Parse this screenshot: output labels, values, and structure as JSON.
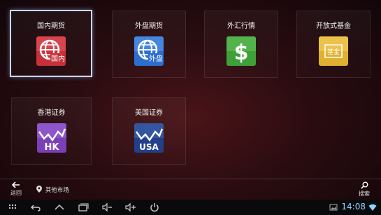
{
  "tiles": [
    {
      "label": "国内期货",
      "badge": "国内",
      "icon": "globe-icon",
      "color": "#c8303a"
    },
    {
      "label": "外盘期货",
      "badge": "外盘",
      "icon": "globe-icon",
      "color": "#2d6fd0"
    },
    {
      "label": "外汇行情",
      "badge": "$",
      "icon": "dollar-icon",
      "color": "#3fa03a"
    },
    {
      "label": "开放式基金",
      "badge": "基金",
      "icon": "fund-icon",
      "color": "#e0b030"
    },
    {
      "label": "香港证券",
      "badge": "HK",
      "icon": "chart-icon",
      "color": "#7a40b8"
    },
    {
      "label": "美国证券",
      "badge": "USA",
      "icon": "chart-icon",
      "color": "#233f8a"
    }
  ],
  "bottom_bar": {
    "back_label": "返回",
    "other_market_label": "其他市场",
    "search_label": "搜索"
  },
  "system_bar": {
    "time": "14:08"
  }
}
